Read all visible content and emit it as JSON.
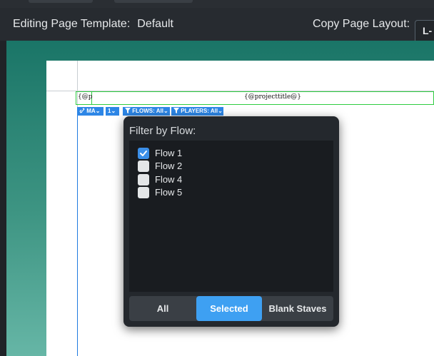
{
  "header": {
    "editing_label": "Editing Page Template:",
    "template_name": "Default",
    "copy_label": "Copy Page Layout:",
    "layout_button_glyph": "L-"
  },
  "page": {
    "left_frame_text": "{@p",
    "title_frame_text": "{@projecttitle@}",
    "chips": [
      {
        "icon": "link-icon",
        "label": "MA"
      },
      {
        "label": "1"
      },
      {
        "icon": "filter-icon",
        "label": "FLOWS: All"
      },
      {
        "icon": "filter-icon",
        "label": "PLAYERS: All"
      }
    ]
  },
  "filter_popup": {
    "title": "Filter by Flow:",
    "flows": [
      {
        "label": "Flow 1",
        "checked": true
      },
      {
        "label": "Flow 2",
        "checked": false
      },
      {
        "label": "Flow 4",
        "checked": false
      },
      {
        "label": "Flow 5",
        "checked": false
      }
    ],
    "buttons": {
      "all": "All",
      "selected": "Selected",
      "blank_staves": "Blank Staves"
    },
    "selected_button": "Selected"
  },
  "colors": {
    "accent": "#3ea0f2",
    "frame_green": "#2ecc40",
    "canvas_teal": "#1a7567"
  }
}
